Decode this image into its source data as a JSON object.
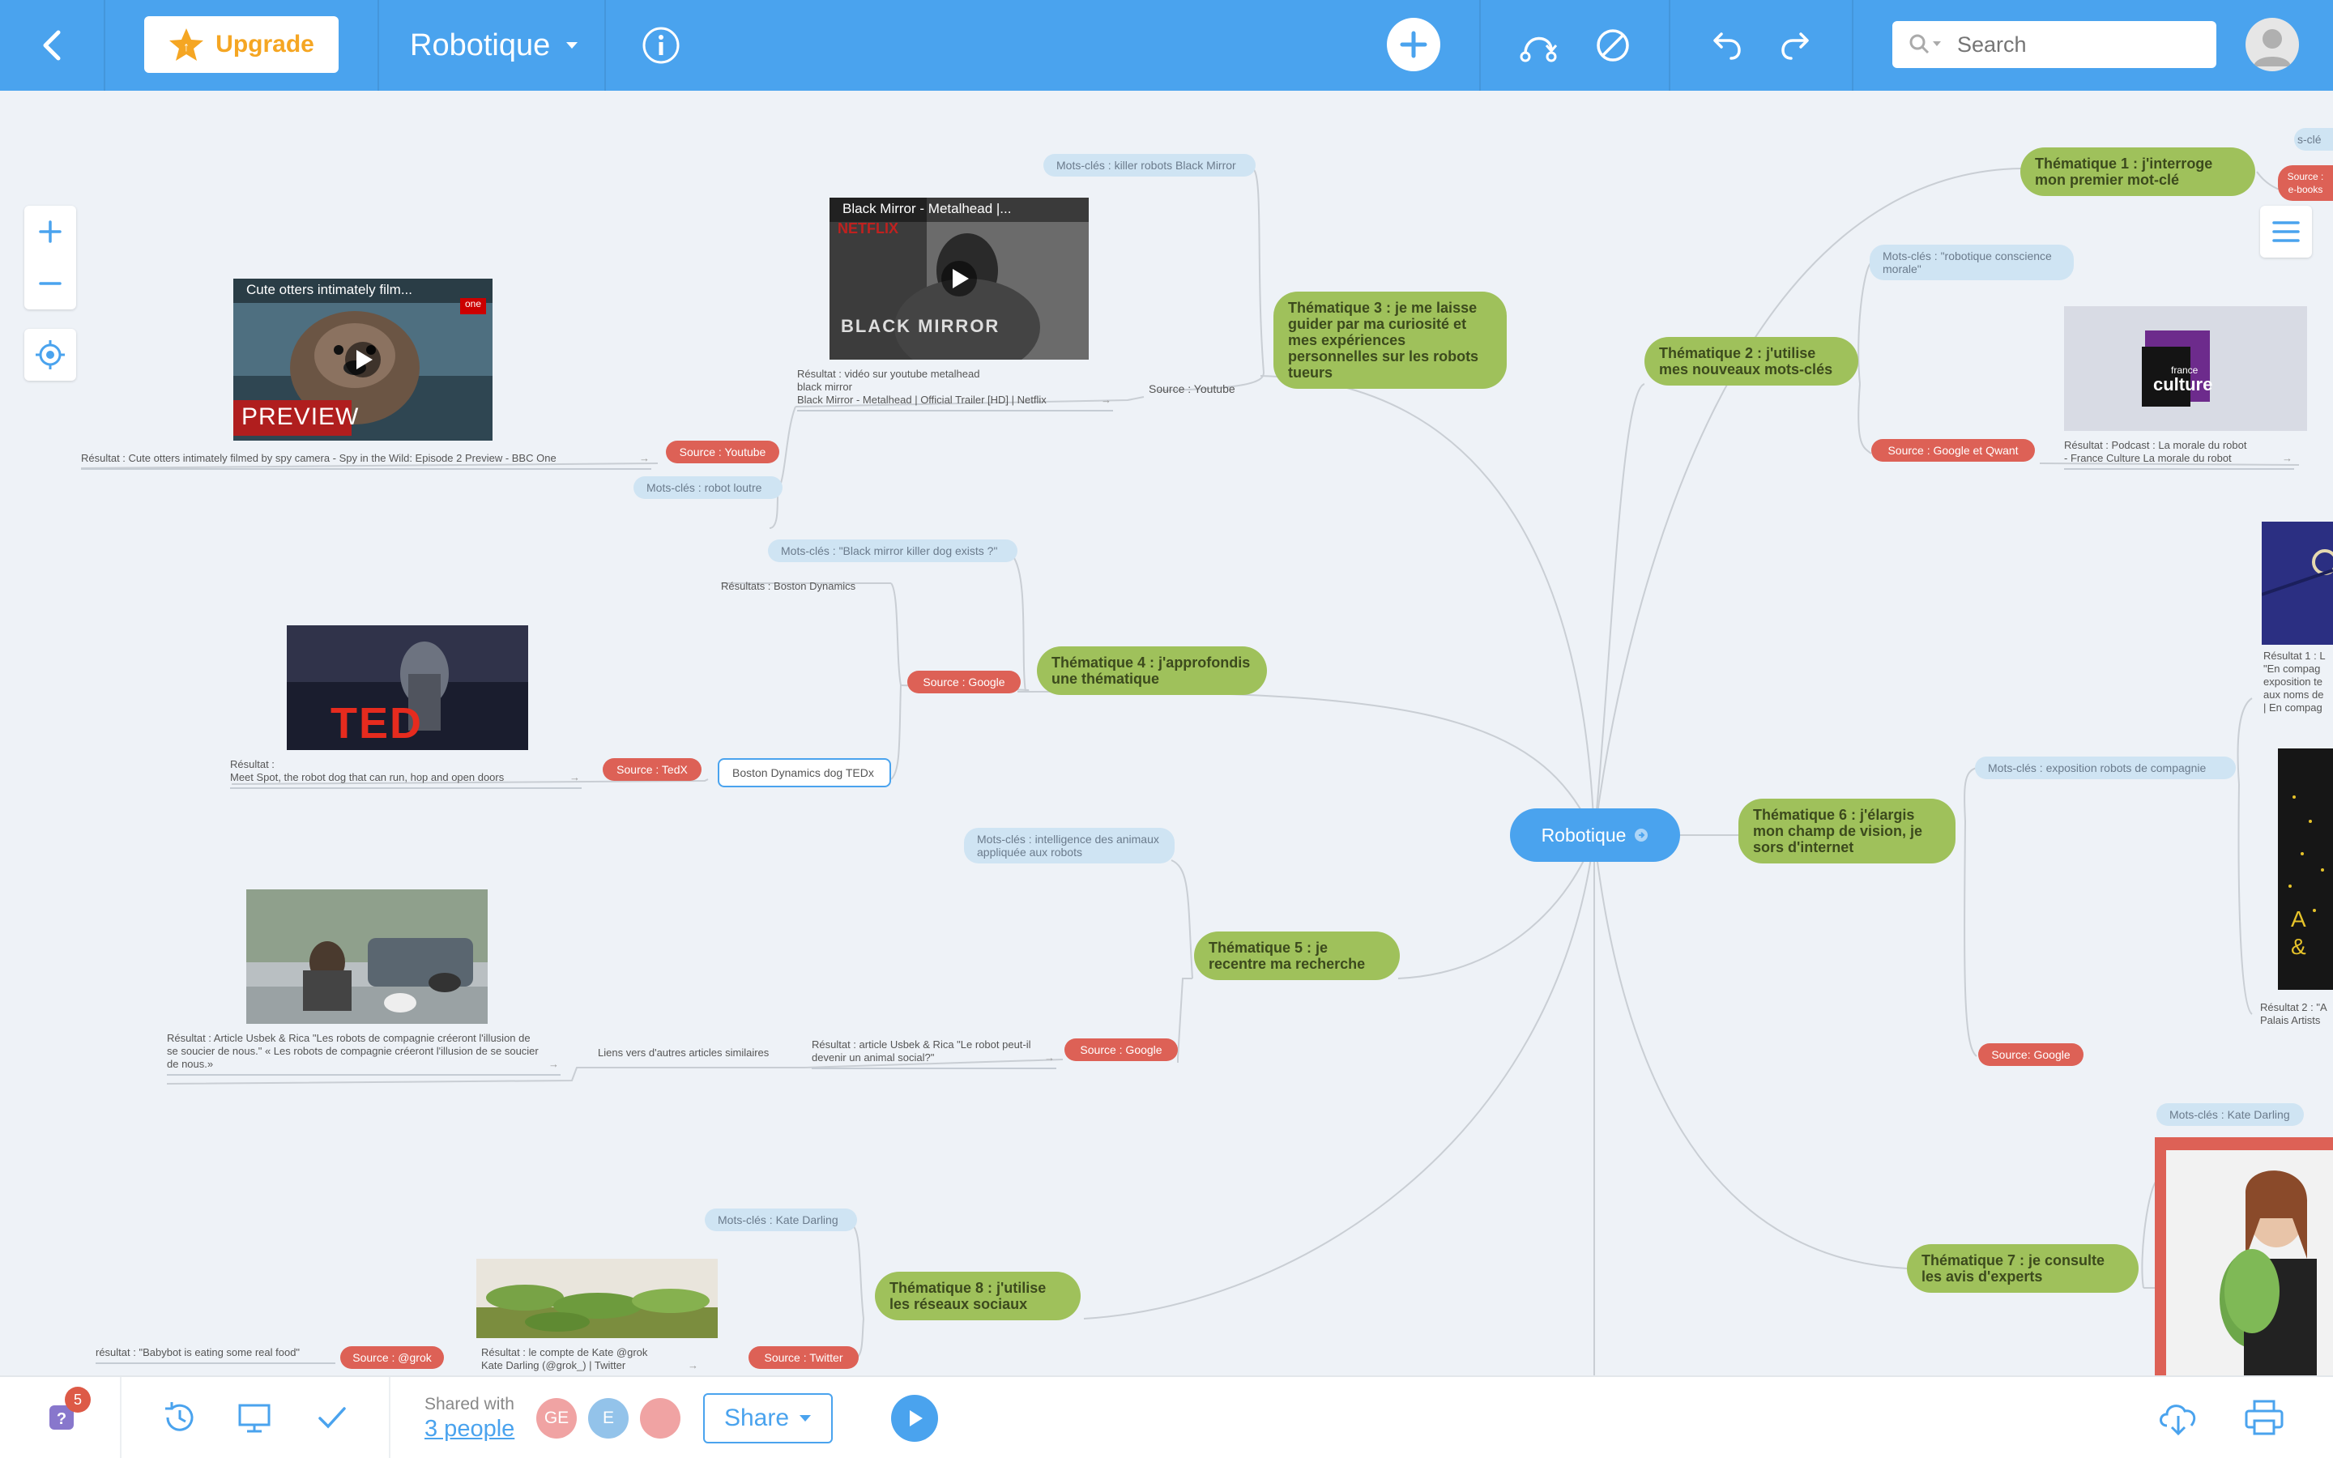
{
  "toolbar": {
    "upgrade_label": "Upgrade",
    "map_title": "Robotique",
    "search_placeholder": "Search"
  },
  "map": {
    "root": "Robotique",
    "themes": {
      "t1": "Thématique 1 : j'interroge mon premier mot-clé",
      "t2": "Thématique 2 : j'utilise mes nouveaux mots-clés",
      "t3": "Thématique 3 : je me laisse guider par ma curiosité et mes expériences personnelles sur les robots tueurs",
      "t4": "Thématique 4  : j'approfondis une thématique",
      "t5": "Thématique 5 : je recentre ma recherche",
      "t6": "Thématique 6 : j'élargis mon champ de vision, je sors d'internet",
      "t7": "Thématique 7 : je consulte les avis d'experts",
      "t8": "Thématique  8 : j'utilise les réseaux sociaux"
    },
    "keywords": {
      "k3": "Mots-clés : killer robots Black Mirror",
      "k_otter": "Mots-clés : robot loutre",
      "k4": "Mots-clés : \"Black mirror killer dog exists ?\"",
      "k5": "Mots-clés : intelligence des animaux appliquée aux robots",
      "k8": "Mots-clés : Kate Darling",
      "k2": "Mots-clés : \"robotique conscience morale\"",
      "k6": "Mots-clés : exposition robots de compagnie",
      "k7": "Mots-clés : Kate Darling",
      "k1": "s-clé"
    },
    "sources": {
      "s_youtube_otter": "Source : Youtube",
      "s3_text": "Source :  Youtube",
      "s4_google": "Source : Google",
      "s4_tedx": "Source : TedX",
      "s5_google": "Source : Google",
      "s8_grok": "Source : @grok",
      "s8_twitter": "Source : Twitter",
      "s2_google": "Source : Google et Qwant",
      "s6_google": "Source: Google",
      "s1_partial": "Source :\ne-books"
    },
    "notes": {
      "otter_result": "Résultat : Cute otters intimately filmed by spy camera - Spy in the Wild: Episode 2 Preview - BBC One",
      "bm_result": "Résultat : vidéo sur youtube metalhead\nblack mirror\nBlack Mirror - Metalhead | Official Trailer [HD] | Netflix",
      "t4_results": "Résultats : Boston Dynamics",
      "ted_result": "Résultat :\nMeet Spot, the robot dog that can run, hop and open doors",
      "ted_box": "Boston Dynamics dog TEDx",
      "usbek1": "Résultat : Article Usbek & Rica \"Les robots de compagnie créeront l'illusion de se soucier de nous.\" « Les robots de compagnie créeront l'illusion de se soucier de nous.»",
      "similar": "Liens vers d'autres articles similaires",
      "usbek2": "Résultat : article Usbek & Rica \"Le robot peut-il devenir un animal social?\"",
      "babybot": "résultat : \"Babybot is eating some real food\"",
      "kate_tw": "Résultat : le compte de Kate @grok\nKate Darling (@grok_) | Twitter",
      "fc_result": "Résultat : Podcast : La morale du robot\n- France Culture La morale du robot",
      "res1_partial": "Résultat 1 : L\n\"En compag\nexposition te\naux noms de\n| En compag",
      "res2_partial": "Résultat 2 : \"A\nPalais Artists"
    },
    "thumbnails": {
      "otter_title": "Cute otters intimately film...",
      "otter_overlay": "PREVIEW",
      "otter_channel": "one",
      "bm_title": "Black Mirror - Metalhead |...",
      "bm_brand": "NETFLIX",
      "bm_overlay": "BLACK MIRROR",
      "ted_text": "TED",
      "fc_line1": "france",
      "fc_line2": "culture"
    }
  },
  "bottombar": {
    "notification_count": "5",
    "shared_with": "Shared with",
    "people_link": "3 people",
    "users": [
      {
        "initials": "GE",
        "color": "#f0a3a3"
      },
      {
        "initials": "E",
        "color": "#93c3ea"
      },
      {
        "initials": "",
        "color": "#f0a3a3"
      }
    ],
    "share_label": "Share"
  },
  "colors": {
    "accent": "#4aa3ee",
    "theme_green": "#9fc15b",
    "source_red": "#dd6156",
    "keyword_blue": "#cfe4f3"
  }
}
